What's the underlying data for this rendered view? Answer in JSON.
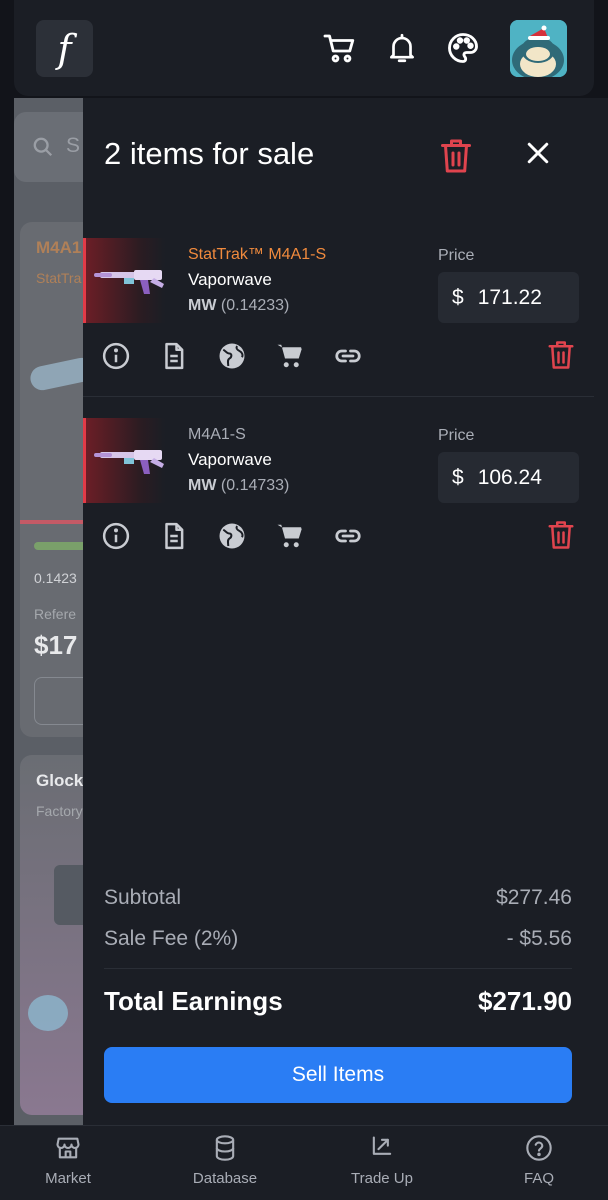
{
  "header": {
    "logo_text": "f",
    "icons": [
      "cart-icon",
      "bell-icon",
      "palette-icon"
    ]
  },
  "background": {
    "card1_title": "M4A1",
    "card1_sub": "StatTra",
    "card1_float": "0.1423",
    "card1_ref_label": "Refere",
    "card1_price": "$17",
    "card2_title": "Glock",
    "card2_sub": "Factory",
    "search_fragment": "S"
  },
  "drawer": {
    "title": "2 items for sale",
    "items": [
      {
        "type": "StatTrak™ M4A1-S",
        "name": "Vaporwave",
        "wear": "MW",
        "float": "(0.14233)",
        "price_label": "Price",
        "currency": "$",
        "price": "171.22"
      },
      {
        "type": "M4A1-S",
        "name": "Vaporwave",
        "wear": "MW",
        "float": "(0.14733)",
        "price_label": "Price",
        "currency": "$",
        "price": "106.24"
      }
    ],
    "summary": {
      "subtotal_label": "Subtotal",
      "subtotal_value": "$277.46",
      "fee_label": "Sale Fee (2%)",
      "fee_value": "- $5.56",
      "total_label": "Total Earnings",
      "total_value": "$271.90"
    },
    "sell_button": "Sell Items"
  },
  "nav": {
    "items": [
      {
        "label": "Market",
        "icon": "store-icon"
      },
      {
        "label": "Database",
        "icon": "database-icon"
      },
      {
        "label": "Trade Up",
        "icon": "trade-up-icon"
      },
      {
        "label": "FAQ",
        "icon": "help-icon"
      }
    ]
  },
  "colors": {
    "accent": "#2a7df4",
    "danger": "#e0444e",
    "stattrak": "#f08a3d",
    "panel": "#1b1e25"
  }
}
